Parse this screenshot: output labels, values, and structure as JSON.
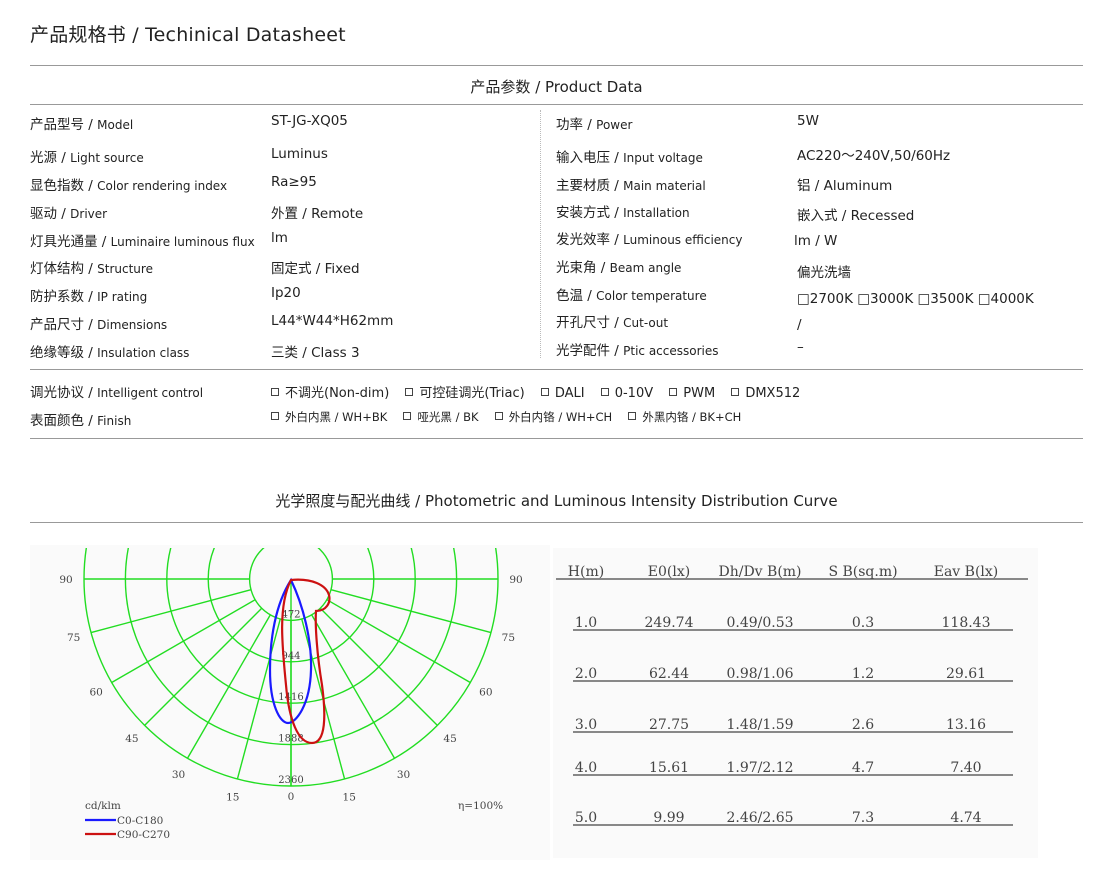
{
  "title": "产品规格书 / Techinical Datasheet",
  "product_section": "产品参数 / Product Data",
  "left_specs": [
    {
      "zh": "产品型号 / ",
      "en": "Model",
      "value": "ST-JG-XQ05"
    },
    {
      "zh": "光源 / ",
      "en": "Light source",
      "value": "Luminus"
    },
    {
      "zh": "显色指数 / ",
      "en": "Color rendering index",
      "value": "Ra≥95"
    },
    {
      "zh": "驱动 / ",
      "en": "Driver",
      "value": "外置 / Remote"
    },
    {
      "zh": "灯具光通量 / ",
      "en": "Luminaire luminous flux",
      "value": "lm"
    },
    {
      "zh": "灯体结构 / ",
      "en": "Structure",
      "value": "固定式 / Fixed"
    },
    {
      "zh": "防护系数 / ",
      "en": "IP rating",
      "value": "Ip20"
    },
    {
      "zh": "产品尺寸 / ",
      "en": "Dimensions",
      "value": "L44*W44*H62mm"
    },
    {
      "zh": "绝缘等级 / ",
      "en": "Insulation class",
      "value": "三类 / Class 3"
    }
  ],
  "right_specs": [
    {
      "zh": "功率 / ",
      "en": "Power",
      "value": "5W"
    },
    {
      "zh": "输入电压 / ",
      "en": "Input voltage",
      "value": "AC220～240V,50/60Hz"
    },
    {
      "zh": "主要材质 / ",
      "en": "Main material",
      "value": "铝 / Aluminum"
    },
    {
      "zh": "安装方式 / ",
      "en": "Installation",
      "value": "嵌入式 / Recessed"
    },
    {
      "zh": "发光效率 / ",
      "en": "Luminous efficiency",
      "value": "lm / W"
    },
    {
      "zh": "光束角 / ",
      "en": "Beam angle",
      "value": "偏光洗墙"
    },
    {
      "zh": "色温 / ",
      "en": "Color temperature",
      "value": "□2700K □3000K □3500K □4000K"
    },
    {
      "zh": "开孔尺寸 / ",
      "en": "Cut-out",
      "value": "/"
    },
    {
      "zh": "光学配件 / ",
      "en": "Ptic accessories",
      "value": "–"
    }
  ],
  "control": {
    "zh": "调光协议 / ",
    "en": "Intelligent control",
    "options": [
      "不调光(Non-dim)",
      "可控硅调光(Triac)",
      "DALI",
      "0-10V",
      "PWM",
      "DMX512"
    ]
  },
  "finish": {
    "zh": "表面颜色 / ",
    "en": "Finish",
    "options": [
      "外白内黑 / WH+BK",
      "哑光黑 / BK",
      "外白内铬 / WH+CH",
      "外黑内铬 / BK+CH"
    ]
  },
  "photometric_section": "光学照度与配光曲线 / Photometric and Luminous Intensity Distribution Curve",
  "polar": {
    "angle_labels_left": [
      "90",
      "75",
      "60",
      "45",
      "30",
      "15"
    ],
    "angle_labels_right": [
      "90",
      "75",
      "60",
      "45",
      "30",
      "15"
    ],
    "bottom_angle": "0",
    "ring_values": [
      "472",
      "944",
      "1416",
      "1888",
      "2360"
    ],
    "unit": "cd/klm",
    "efficiency": "η=100%",
    "legend": [
      {
        "name": "C0-C180",
        "color": "#1a1aff"
      },
      {
        "name": "C90-C270",
        "color": "#cc1111"
      }
    ],
    "grid_color": "#22dd22"
  },
  "illuminance_table": {
    "headers": [
      "H(m)",
      "E0(lx)",
      "Dh/Dv B(m)",
      "S B(sq.m)",
      "Eav B(lx)"
    ],
    "rows": [
      [
        "1.0",
        "249.74",
        "0.49/0.53",
        "0.3",
        "118.43"
      ],
      [
        "2.0",
        "62.44",
        "0.98/1.06",
        "1.2",
        "29.61"
      ],
      [
        "3.0",
        "27.75",
        "1.48/1.59",
        "2.6",
        "13.16"
      ],
      [
        "4.0",
        "15.61",
        "1.97/2.12",
        "4.7",
        "7.40"
      ],
      [
        "5.0",
        "9.99",
        "2.46/2.65",
        "7.3",
        "4.74"
      ]
    ]
  }
}
